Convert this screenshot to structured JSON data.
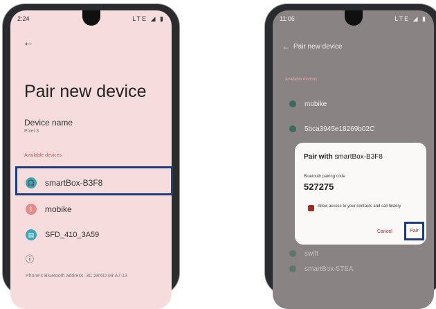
{
  "left_phone": {
    "status_time": "2:24",
    "status_icons": "LTE ◢ ▮",
    "back_glyph": "←",
    "title": "Pair new device",
    "device_name_label": "Device name",
    "device_name_value": "Pixel 3",
    "available_devices_label": "Available devices",
    "devices": [
      {
        "name": "smartBox-B3F8",
        "icon": "headset-icon",
        "icon_color": "#3aa7b6"
      },
      {
        "name": "mobike",
        "icon": "bluetooth-icon",
        "icon_color": "#e48b8b"
      },
      {
        "name": "SFD_410_3A59",
        "icon": "printer-icon",
        "icon_color": "#3aa7b6"
      }
    ],
    "info_glyph": "ⓘ",
    "bluetooth_address_text": "Phone's Bluetooth address: 3C:28:6D:09:A7:13"
  },
  "right_phone": {
    "status_time": "11:06",
    "status_icons": "LTE ◢ ▮",
    "back_glyph": "←",
    "title": "Pair new device",
    "available_devices_label": "Available devices",
    "devices": [
      {
        "name": "mobike"
      },
      {
        "name": "5bca3945e18269b02C"
      },
      {
        "name": "swift"
      },
      {
        "name": "smartBox-5TEA"
      }
    ],
    "dialog": {
      "title_prefix": "Pair with",
      "title_device": "smartBox-B3F8",
      "code_label": "Bluetooth pairing code",
      "code": "527275",
      "checkbox_text": "Allow access to your contacts and call history",
      "cancel_label": "Cancel",
      "pair_label": "Pair"
    }
  },
  "colors": {
    "highlight_border": "#1f3a7a",
    "accent": "#9e2a2a",
    "left_screen_bg": "#f6dcdd"
  }
}
